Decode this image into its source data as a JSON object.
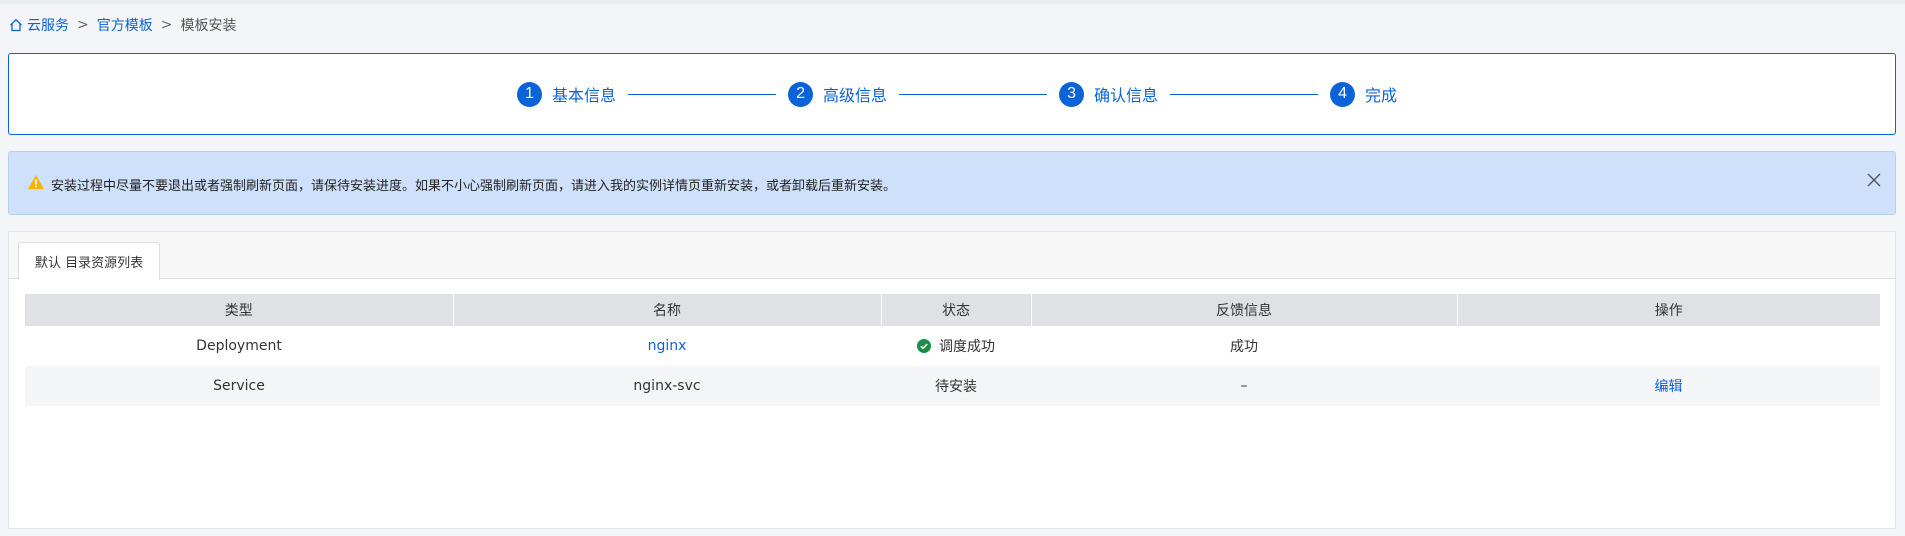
{
  "breadcrumb": {
    "items": [
      "云服务",
      "官方模板"
    ],
    "current": "模板安装",
    "separator": ">"
  },
  "steps": [
    {
      "num": "1",
      "label": "基本信息"
    },
    {
      "num": "2",
      "label": "高级信息"
    },
    {
      "num": "3",
      "label": "确认信息"
    },
    {
      "num": "4",
      "label": "完成"
    }
  ],
  "alert": {
    "text": "安装过程中尽量不要退出或者强制刷新页面，请保待安装进度。如果不小心强制刷新页面，请进入我的实例详情页重新安装，或者卸载后重新安装。"
  },
  "tab": {
    "label": "默认 目录资源列表"
  },
  "table": {
    "headers": [
      "类型",
      "名称",
      "状态",
      "反馈信息",
      "操作"
    ],
    "rows": [
      {
        "type": "Deployment",
        "name": "nginx",
        "status": "调度成功",
        "feedback": "成功",
        "action": ""
      },
      {
        "type": "Service",
        "name": "nginx-svc",
        "status": "待安装",
        "feedback": "–",
        "action": "编辑"
      }
    ]
  },
  "colors": {
    "accent": "#0b63d8",
    "alert_bg": "#cfe0fb",
    "success": "#1a8f4a",
    "warning": "#f5b400"
  }
}
